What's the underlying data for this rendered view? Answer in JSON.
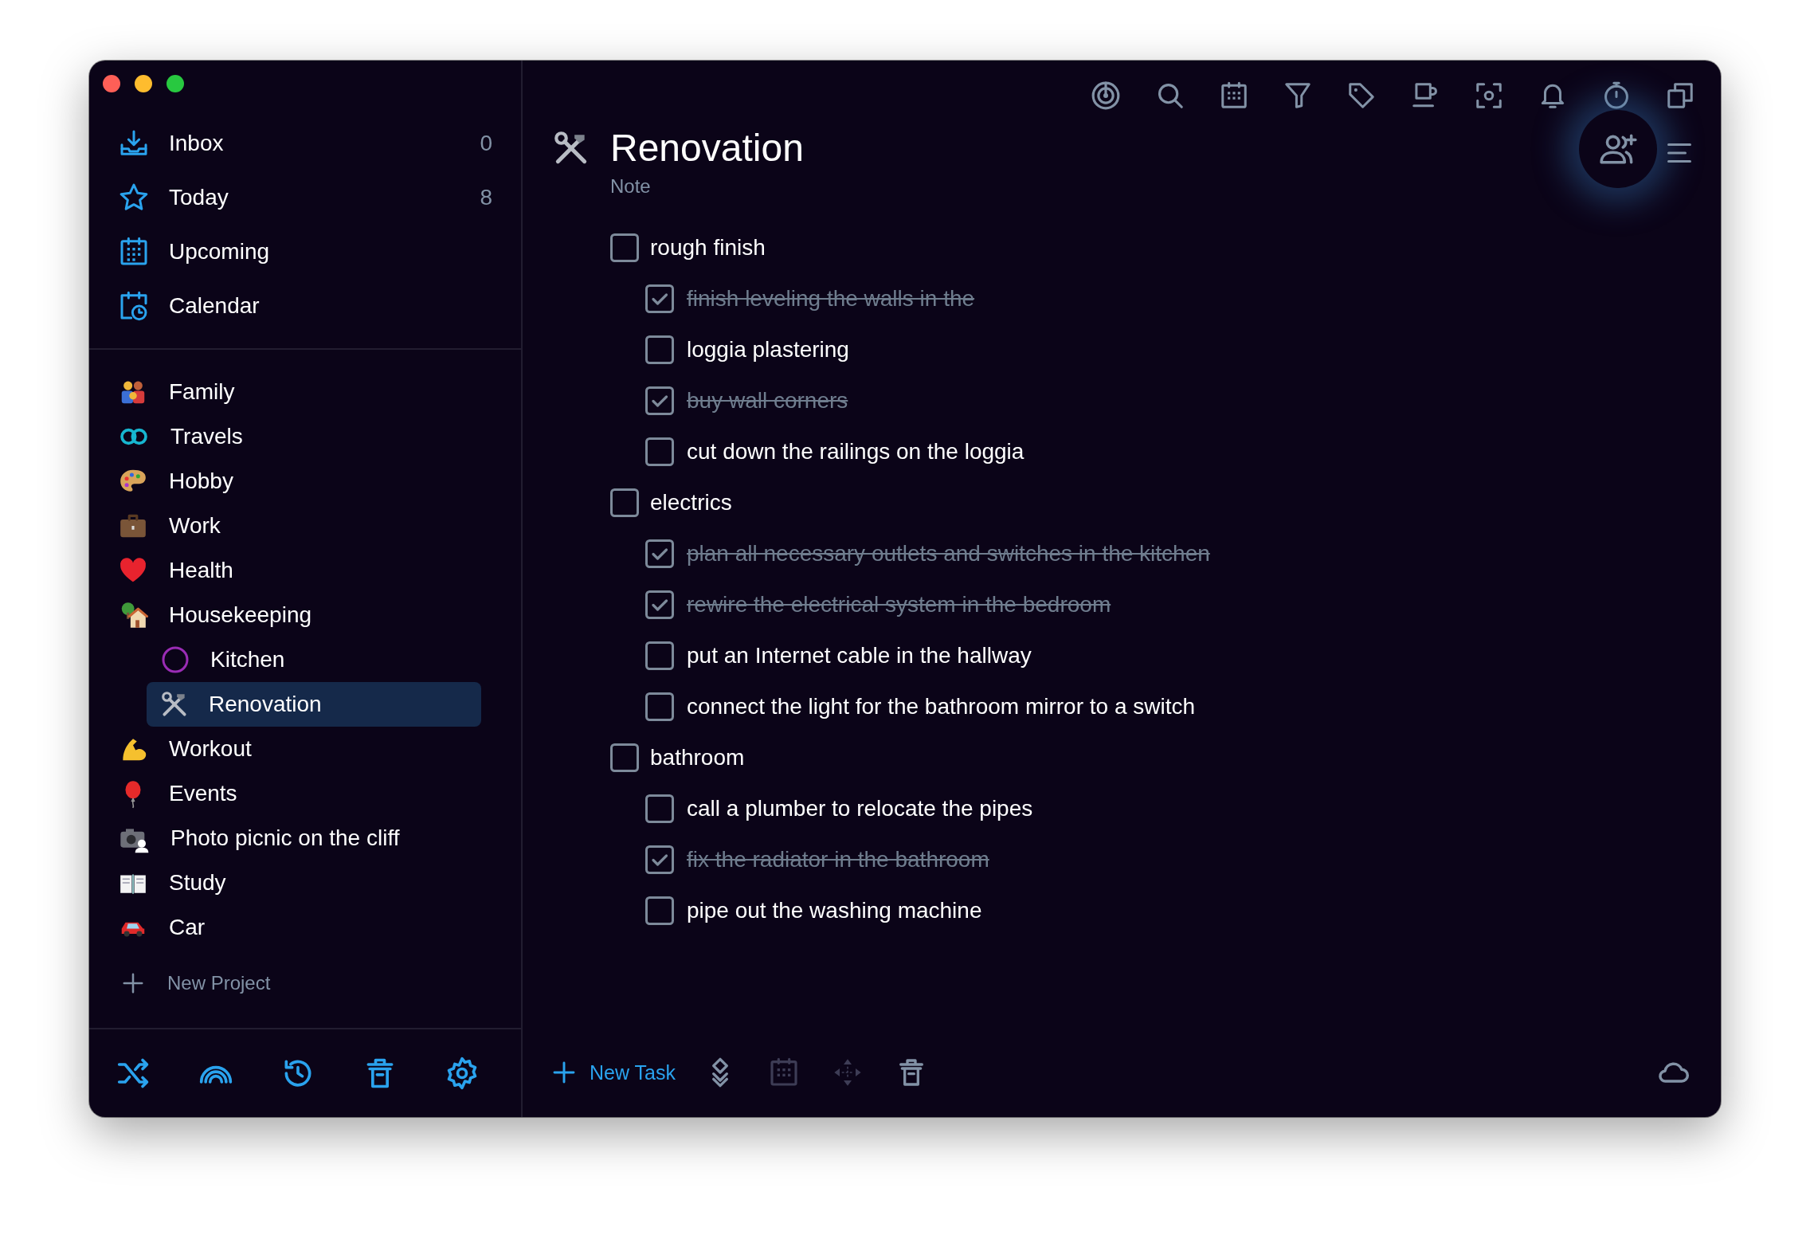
{
  "sidebar": {
    "nav": [
      {
        "label": "Inbox",
        "count": "0"
      },
      {
        "label": "Today",
        "count": "8"
      },
      {
        "label": "Upcoming"
      },
      {
        "label": "Calendar"
      }
    ],
    "projects": [
      {
        "label": "Family",
        "selected": false
      },
      {
        "label": "Travels",
        "selected": false
      },
      {
        "label": "Hobby",
        "selected": false
      },
      {
        "label": "Work",
        "selected": false
      },
      {
        "label": "Health",
        "selected": false
      },
      {
        "label": "Housekeeping",
        "selected": false,
        "children": [
          {
            "label": "Kitchen",
            "selected": false
          },
          {
            "label": "Renovation",
            "selected": true
          }
        ]
      },
      {
        "label": "Workout",
        "selected": false
      },
      {
        "label": "Events",
        "selected": false
      },
      {
        "label": "Photo picnic on the cliff",
        "selected": false
      },
      {
        "label": "Study",
        "selected": false
      },
      {
        "label": "Car",
        "selected": false
      }
    ],
    "new_project": "New Project"
  },
  "project": {
    "title": "Renovation",
    "note_placeholder": "Note"
  },
  "tasks": [
    {
      "label": "rough finish",
      "checked": false,
      "children": [
        {
          "label": "finish leveling the walls in the",
          "checked": true
        },
        {
          "label": "loggia plastering",
          "checked": false
        },
        {
          "label": "buy wall corners",
          "checked": true
        },
        {
          "label": "cut down the railings on the loggia",
          "checked": false
        }
      ]
    },
    {
      "label": "electrics",
      "checked": false,
      "children": [
        {
          "label": "plan all necessary outlets and switches in the kitchen",
          "checked": true
        },
        {
          "label": "rewire the electrical system in the bedroom",
          "checked": true
        },
        {
          "label": "put an Internet cable in the hallway",
          "checked": false
        },
        {
          "label": "connect the light for the bathroom mirror to a switch",
          "checked": false
        }
      ]
    },
    {
      "label": "bathroom",
      "checked": false,
      "children": [
        {
          "label": "call a plumber to relocate the pipes",
          "checked": false
        },
        {
          "label": "fix the radiator in the bathroom",
          "checked": true
        },
        {
          "label": "pipe out the washing machine",
          "checked": false
        }
      ]
    }
  ],
  "bottom_bar": {
    "new_task": "New Task"
  }
}
